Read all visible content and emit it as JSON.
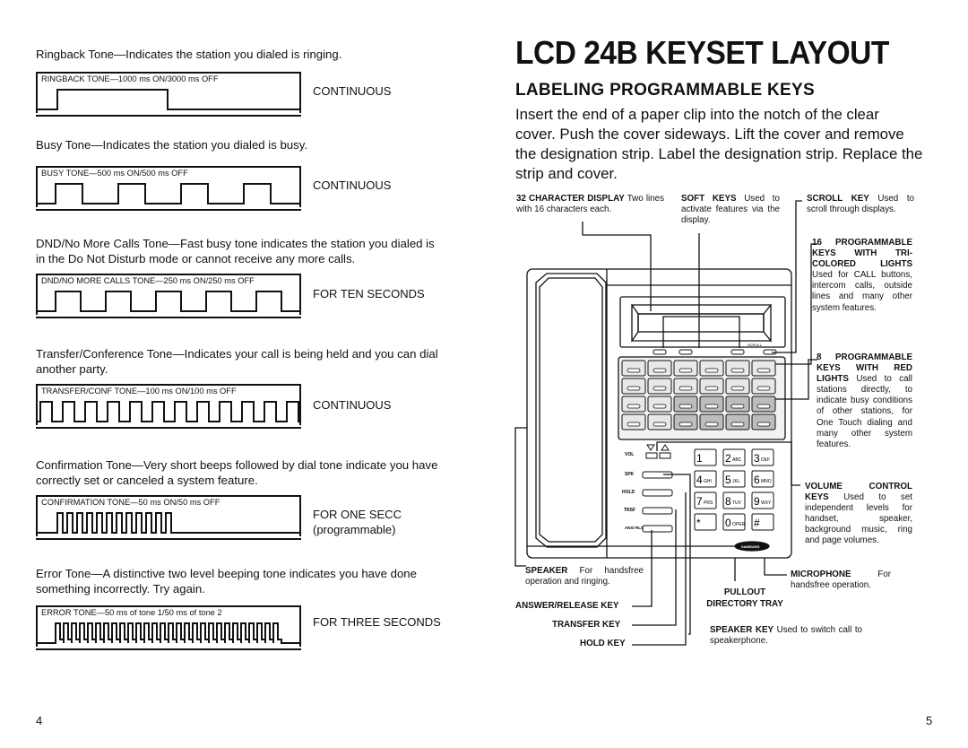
{
  "left_page": {
    "tones": [
      {
        "description": "Ringback Tone—Indicates the station you dialed is ringing.",
        "graph_label": "RINGBACK TONE—1000 ms ON/3000 ms OFF",
        "duration": "CONTINUOUS",
        "duration_note": ""
      },
      {
        "description": "Busy Tone—Indicates the station you dialed is busy.",
        "graph_label": "BUSY TONE—500 ms ON/500 ms OFF",
        "duration": "CONTINUOUS",
        "duration_note": ""
      },
      {
        "description": "DND/No More Calls Tone—Fast busy tone indicates the station you dialed is in the Do Not Disturb mode or cannot receive any more calls.",
        "graph_label": "DND/NO MORE CALLS TONE—250 ms ON/250 ms OFF",
        "duration": "FOR TEN SECONDS",
        "duration_note": ""
      },
      {
        "description": "Transfer/Conference Tone—Indicates your call is being held and you can dial another party.",
        "graph_label": "TRANSFER/CONF TONE—100 ms ON/100 ms OFF",
        "duration": "CONTINUOUS",
        "duration_note": ""
      },
      {
        "description": "Confirmation Tone—Very short beeps followed by dial tone indicate you have correctly set or canceled a system feature.",
        "graph_label": "CONFIRMATION TONE—50 ms ON/50 ms OFF",
        "duration": "FOR ONE SECC",
        "duration_note": "(programmable)"
      },
      {
        "description": "Error Tone—A distinctive two level beeping tone indicates you have done something incorrectly. Try again.",
        "graph_label": "ERROR TONE—50 ms of tone 1/50 ms of tone 2",
        "duration": "FOR THREE SECONDS",
        "duration_note": ""
      }
    ],
    "page_number": "4"
  },
  "right_page": {
    "title": "LCD 24B KEYSET LAYOUT",
    "subtitle": "LABELING PROGRAMMABLE KEYS",
    "intro": "Insert the end of a paper clip into the notch of the clear cover. Push the cover sideways. Lift the cover and remove the designation strip. Label the designation strip. Replace the strip and cover.",
    "captions": {
      "display": {
        "head": "32 CHARACTER DISPLAY",
        "body": " Two lines with 16 characters each."
      },
      "soft_keys": {
        "head": "SOFT KEYS",
        "body": " Used to activate features via the display."
      },
      "scroll_key": {
        "head": "SCROLL KEY",
        "body": " Used to scroll through displays."
      },
      "tri_keys": {
        "head": "16 PROGRAMMABLE KEYS WITH TRI-COLORED LIGHTS",
        "body": " Used for CALL buttons, intercom calls, outside lines and many other system features."
      },
      "red_keys": {
        "head": "8 PROGRAMMABLE KEYS WITH RED LIGHTS",
        "body": " Used to call stations directly, to indicate busy conditions of other stations, for One Touch dialing and many other system features."
      },
      "volume": {
        "head": "VOLUME CONTROL KEYS",
        "body": " Used to set independent levels for handset, speaker, background music, ring and page volumes."
      },
      "speaker": {
        "head": "SPEAKER",
        "body": " For handsfree operation and ringing."
      },
      "microphone": {
        "head": "MICROPHONE",
        "body": " For handsfree operation."
      },
      "speaker_key": {
        "head": "SPEAKER KEY",
        "body": " Used to switch call to speakerphone."
      }
    },
    "callouts": {
      "answer_release": "ANSWER/RELEASE KEY",
      "transfer": "TRANSFER KEY",
      "hold": "HOLD KEY",
      "pullout": "PULLOUT DIRECTORY TRAY"
    },
    "phone_labels": {
      "scroll": "SCROLL",
      "vol": "VOL",
      "spk": "SPK",
      "hold": "HOLD",
      "trsf": "TRSF",
      "ans": "ANS/ RLS",
      "brand": "SAMSUNG",
      "keypad": [
        [
          "1",
          ""
        ],
        [
          "2",
          "ABC"
        ],
        [
          "3",
          "DEF"
        ],
        [
          "4",
          "GHI"
        ],
        [
          "5",
          "JKL"
        ],
        [
          "6",
          "MNO"
        ],
        [
          "7",
          "PRS"
        ],
        [
          "8",
          "TUV"
        ],
        [
          "9",
          "WXY"
        ],
        [
          "*",
          ""
        ],
        [
          "0",
          "OPER"
        ],
        [
          "#",
          ""
        ]
      ]
    },
    "page_number": "5"
  }
}
